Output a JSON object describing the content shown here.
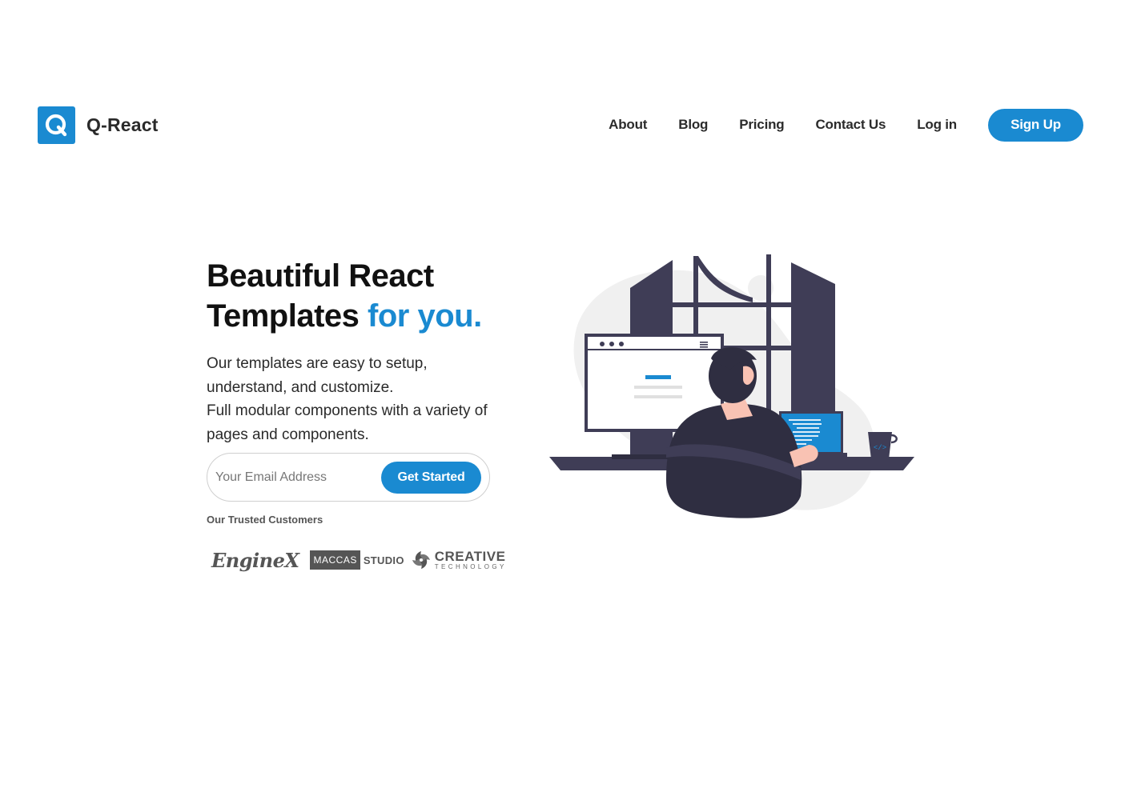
{
  "header": {
    "brand_letter": "Q",
    "brand_name": "Q-React",
    "nav": [
      {
        "label": "About"
      },
      {
        "label": "Blog"
      },
      {
        "label": "Pricing"
      },
      {
        "label": "Contact Us"
      },
      {
        "label": "Log in"
      }
    ],
    "signup_label": "Sign Up"
  },
  "hero": {
    "headline_line1": "Beautiful React",
    "headline_line2_plain": "Templates",
    "headline_line2_accent": "for you.",
    "description_1": "Our templates are easy to setup, understand, and customize.",
    "description_2": "Full modular components with a variety of pages and components.",
    "email_placeholder": "Your Email Address",
    "cta_label": "Get Started",
    "trusted_label": "Our Trusted Customers"
  },
  "customers": {
    "enginex": "EngineX",
    "maccas_box": "MACCAS",
    "maccas_studio": "STUDIO",
    "creative_title": "CREATIVE",
    "creative_sub": "TECHNOLOGY"
  },
  "colors": {
    "accent": "#1a8ad1",
    "dark_illustration": "#3f3d56",
    "text_dark": "#1a1a1a"
  }
}
